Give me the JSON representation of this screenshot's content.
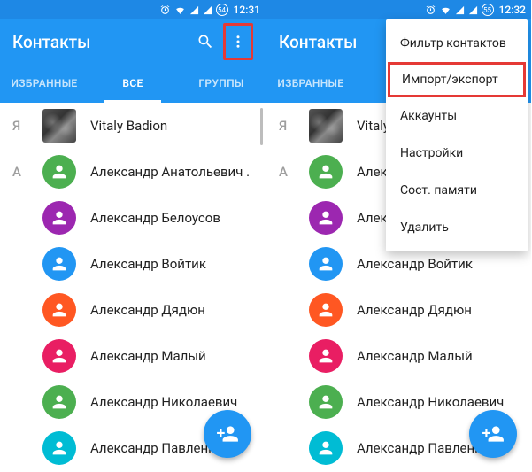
{
  "left": {
    "statusbar": {
      "time": "12:31",
      "notif_badge": "54"
    },
    "appbar": {
      "title": "Контакты"
    },
    "tabs": {
      "favorites": "ИЗБРАННЫЕ",
      "all": "ВСЕ",
      "groups": "ГРУППЫ",
      "active": "all"
    },
    "sections": [
      {
        "letter": "Я",
        "contacts": [
          {
            "name": "Vitaly Badion",
            "avatar_type": "image"
          }
        ]
      },
      {
        "letter": "А",
        "contacts": [
          {
            "name": "Александр Анатольевич .",
            "color": "green"
          },
          {
            "name": "Александр Белоусов",
            "color": "purple"
          },
          {
            "name": "Александр Войтик",
            "color": "blue"
          },
          {
            "name": "Александр Дядюн",
            "color": "orange"
          },
          {
            "name": "Александр Малый",
            "color": "pink"
          },
          {
            "name": "Александр Николаевич",
            "color": "green"
          },
          {
            "name": "Александр Павленко",
            "color": "teal"
          }
        ]
      }
    ]
  },
  "right": {
    "statusbar": {
      "time": "12:32",
      "notif_badge": "55"
    },
    "appbar": {
      "title": "Контакты"
    },
    "tabs": {
      "favorites": "ИЗБРАННЫЕ",
      "active": "favorites_visible_only"
    },
    "menu": {
      "items": [
        {
          "label": "Фильтр контактов",
          "highlight": false
        },
        {
          "label": "Импорт/экспорт",
          "highlight": true
        },
        {
          "label": "Аккаунты",
          "highlight": false
        },
        {
          "label": "Настройки",
          "highlight": false
        },
        {
          "label": "Сост. памяти",
          "highlight": false
        },
        {
          "label": "Удалить",
          "highlight": false
        }
      ]
    },
    "sections": [
      {
        "letter": "Я",
        "contacts": [
          {
            "name": "Vitaly",
            "avatar_type": "image"
          }
        ]
      },
      {
        "letter": "А",
        "contacts": [
          {
            "name": "Алекса",
            "color": "green"
          },
          {
            "name": "Александр Белоусов",
            "color": "purple"
          },
          {
            "name": "Александр Войтик",
            "color": "blue"
          },
          {
            "name": "Александр Дядюн",
            "color": "orange"
          },
          {
            "name": "Александр Малый",
            "color": "pink"
          },
          {
            "name": "Александр Николаевич",
            "color": "green"
          },
          {
            "name": "Александр Павленко",
            "color": "teal"
          }
        ]
      }
    ]
  }
}
